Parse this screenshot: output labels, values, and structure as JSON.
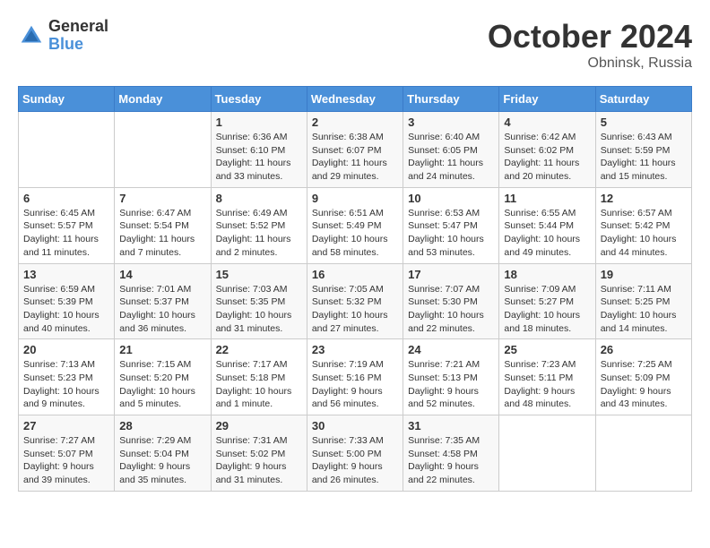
{
  "logo": {
    "general": "General",
    "blue": "Blue"
  },
  "header": {
    "title": "October 2024",
    "location": "Obninsk, Russia"
  },
  "weekdays": [
    "Sunday",
    "Monday",
    "Tuesday",
    "Wednesday",
    "Thursday",
    "Friday",
    "Saturday"
  ],
  "weeks": [
    [
      {
        "day": "",
        "sunrise": "",
        "sunset": "",
        "daylight": ""
      },
      {
        "day": "",
        "sunrise": "",
        "sunset": "",
        "daylight": ""
      },
      {
        "day": "1",
        "sunrise": "Sunrise: 6:36 AM",
        "sunset": "Sunset: 6:10 PM",
        "daylight": "Daylight: 11 hours and 33 minutes."
      },
      {
        "day": "2",
        "sunrise": "Sunrise: 6:38 AM",
        "sunset": "Sunset: 6:07 PM",
        "daylight": "Daylight: 11 hours and 29 minutes."
      },
      {
        "day": "3",
        "sunrise": "Sunrise: 6:40 AM",
        "sunset": "Sunset: 6:05 PM",
        "daylight": "Daylight: 11 hours and 24 minutes."
      },
      {
        "day": "4",
        "sunrise": "Sunrise: 6:42 AM",
        "sunset": "Sunset: 6:02 PM",
        "daylight": "Daylight: 11 hours and 20 minutes."
      },
      {
        "day": "5",
        "sunrise": "Sunrise: 6:43 AM",
        "sunset": "Sunset: 5:59 PM",
        "daylight": "Daylight: 11 hours and 15 minutes."
      }
    ],
    [
      {
        "day": "6",
        "sunrise": "Sunrise: 6:45 AM",
        "sunset": "Sunset: 5:57 PM",
        "daylight": "Daylight: 11 hours and 11 minutes."
      },
      {
        "day": "7",
        "sunrise": "Sunrise: 6:47 AM",
        "sunset": "Sunset: 5:54 PM",
        "daylight": "Daylight: 11 hours and 7 minutes."
      },
      {
        "day": "8",
        "sunrise": "Sunrise: 6:49 AM",
        "sunset": "Sunset: 5:52 PM",
        "daylight": "Daylight: 11 hours and 2 minutes."
      },
      {
        "day": "9",
        "sunrise": "Sunrise: 6:51 AM",
        "sunset": "Sunset: 5:49 PM",
        "daylight": "Daylight: 10 hours and 58 minutes."
      },
      {
        "day": "10",
        "sunrise": "Sunrise: 6:53 AM",
        "sunset": "Sunset: 5:47 PM",
        "daylight": "Daylight: 10 hours and 53 minutes."
      },
      {
        "day": "11",
        "sunrise": "Sunrise: 6:55 AM",
        "sunset": "Sunset: 5:44 PM",
        "daylight": "Daylight: 10 hours and 49 minutes."
      },
      {
        "day": "12",
        "sunrise": "Sunrise: 6:57 AM",
        "sunset": "Sunset: 5:42 PM",
        "daylight": "Daylight: 10 hours and 44 minutes."
      }
    ],
    [
      {
        "day": "13",
        "sunrise": "Sunrise: 6:59 AM",
        "sunset": "Sunset: 5:39 PM",
        "daylight": "Daylight: 10 hours and 40 minutes."
      },
      {
        "day": "14",
        "sunrise": "Sunrise: 7:01 AM",
        "sunset": "Sunset: 5:37 PM",
        "daylight": "Daylight: 10 hours and 36 minutes."
      },
      {
        "day": "15",
        "sunrise": "Sunrise: 7:03 AM",
        "sunset": "Sunset: 5:35 PM",
        "daylight": "Daylight: 10 hours and 31 minutes."
      },
      {
        "day": "16",
        "sunrise": "Sunrise: 7:05 AM",
        "sunset": "Sunset: 5:32 PM",
        "daylight": "Daylight: 10 hours and 27 minutes."
      },
      {
        "day": "17",
        "sunrise": "Sunrise: 7:07 AM",
        "sunset": "Sunset: 5:30 PM",
        "daylight": "Daylight: 10 hours and 22 minutes."
      },
      {
        "day": "18",
        "sunrise": "Sunrise: 7:09 AM",
        "sunset": "Sunset: 5:27 PM",
        "daylight": "Daylight: 10 hours and 18 minutes."
      },
      {
        "day": "19",
        "sunrise": "Sunrise: 7:11 AM",
        "sunset": "Sunset: 5:25 PM",
        "daylight": "Daylight: 10 hours and 14 minutes."
      }
    ],
    [
      {
        "day": "20",
        "sunrise": "Sunrise: 7:13 AM",
        "sunset": "Sunset: 5:23 PM",
        "daylight": "Daylight: 10 hours and 9 minutes."
      },
      {
        "day": "21",
        "sunrise": "Sunrise: 7:15 AM",
        "sunset": "Sunset: 5:20 PM",
        "daylight": "Daylight: 10 hours and 5 minutes."
      },
      {
        "day": "22",
        "sunrise": "Sunrise: 7:17 AM",
        "sunset": "Sunset: 5:18 PM",
        "daylight": "Daylight: 10 hours and 1 minute."
      },
      {
        "day": "23",
        "sunrise": "Sunrise: 7:19 AM",
        "sunset": "Sunset: 5:16 PM",
        "daylight": "Daylight: 9 hours and 56 minutes."
      },
      {
        "day": "24",
        "sunrise": "Sunrise: 7:21 AM",
        "sunset": "Sunset: 5:13 PM",
        "daylight": "Daylight: 9 hours and 52 minutes."
      },
      {
        "day": "25",
        "sunrise": "Sunrise: 7:23 AM",
        "sunset": "Sunset: 5:11 PM",
        "daylight": "Daylight: 9 hours and 48 minutes."
      },
      {
        "day": "26",
        "sunrise": "Sunrise: 7:25 AM",
        "sunset": "Sunset: 5:09 PM",
        "daylight": "Daylight: 9 hours and 43 minutes."
      }
    ],
    [
      {
        "day": "27",
        "sunrise": "Sunrise: 7:27 AM",
        "sunset": "Sunset: 5:07 PM",
        "daylight": "Daylight: 9 hours and 39 minutes."
      },
      {
        "day": "28",
        "sunrise": "Sunrise: 7:29 AM",
        "sunset": "Sunset: 5:04 PM",
        "daylight": "Daylight: 9 hours and 35 minutes."
      },
      {
        "day": "29",
        "sunrise": "Sunrise: 7:31 AM",
        "sunset": "Sunset: 5:02 PM",
        "daylight": "Daylight: 9 hours and 31 minutes."
      },
      {
        "day": "30",
        "sunrise": "Sunrise: 7:33 AM",
        "sunset": "Sunset: 5:00 PM",
        "daylight": "Daylight: 9 hours and 26 minutes."
      },
      {
        "day": "31",
        "sunrise": "Sunrise: 7:35 AM",
        "sunset": "Sunset: 4:58 PM",
        "daylight": "Daylight: 9 hours and 22 minutes."
      },
      {
        "day": "",
        "sunrise": "",
        "sunset": "",
        "daylight": ""
      },
      {
        "day": "",
        "sunrise": "",
        "sunset": "",
        "daylight": ""
      }
    ]
  ]
}
